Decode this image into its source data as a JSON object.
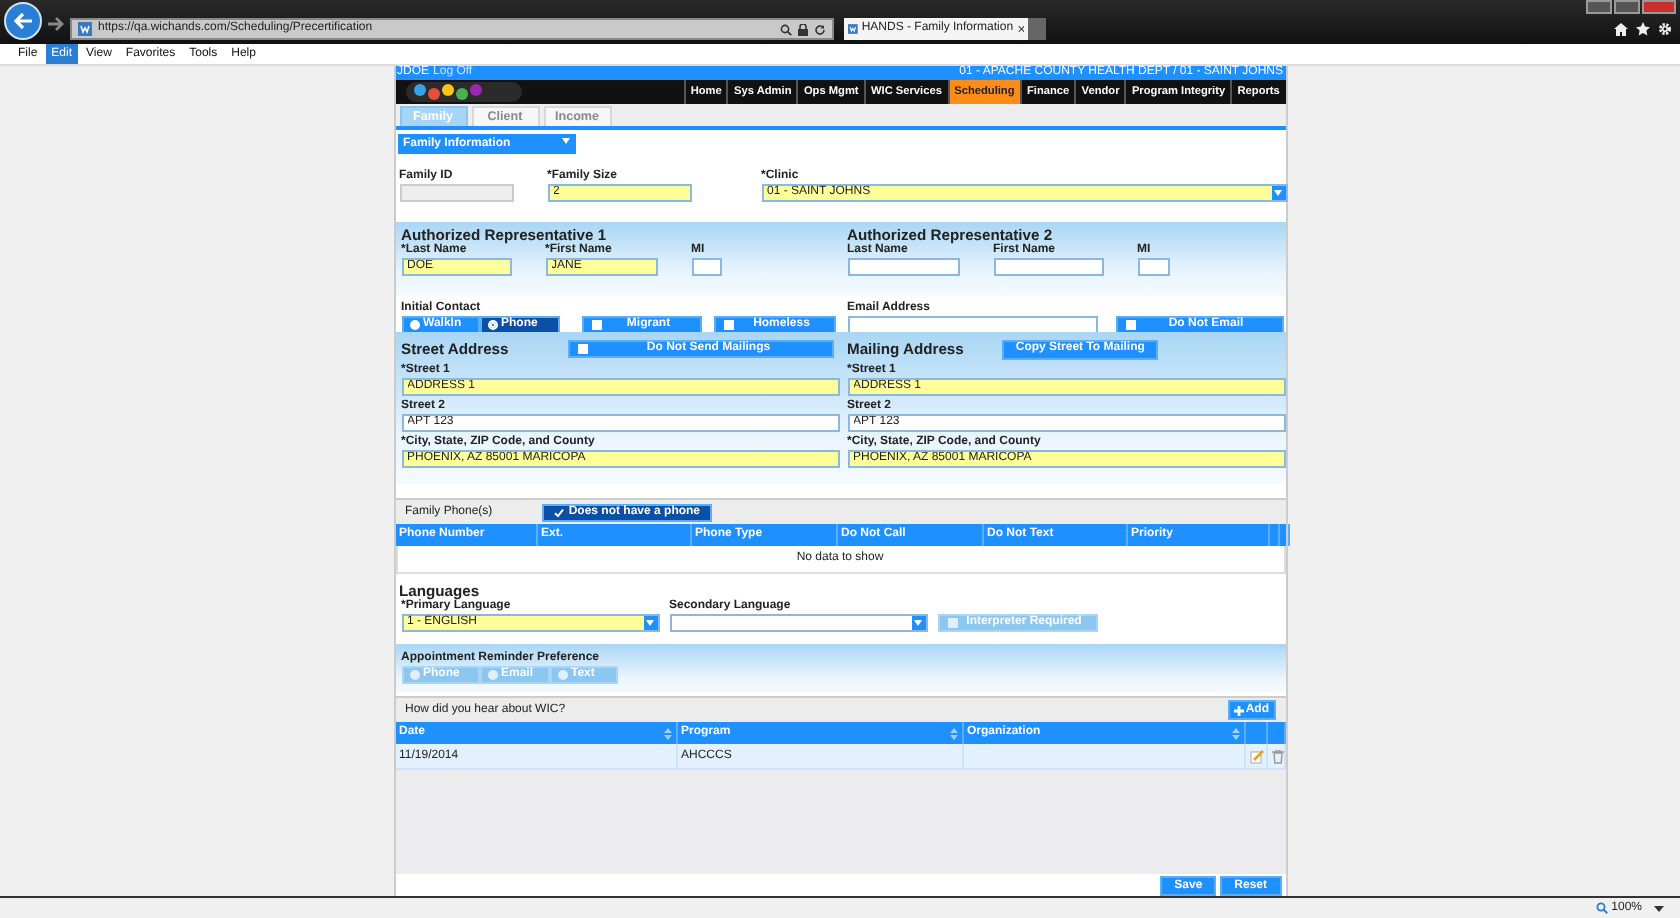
{
  "browser": {
    "url": "https://qa.wichands.com/Scheduling/Precertification",
    "tab_title": "HANDS - Family Information",
    "zoom": "100%",
    "menu": [
      {
        "label": "File",
        "selected": false
      },
      {
        "label": "Edit",
        "selected": true
      },
      {
        "label": "View",
        "selected": false
      },
      {
        "label": "Favorites",
        "selected": false
      },
      {
        "label": "Tools",
        "selected": false
      },
      {
        "label": "Help",
        "selected": false
      }
    ]
  },
  "header": {
    "user": "JDOE",
    "logoff": "Log Off",
    "location": "01 - APACHE COUNTY HEALTH DEPT / 01 - SAINT JOHNS"
  },
  "nav": [
    {
      "label": "Home",
      "selected": false
    },
    {
      "label": "Sys Admin",
      "selected": false
    },
    {
      "label": "Ops Mgmt",
      "selected": false
    },
    {
      "label": "WIC Services",
      "selected": false
    },
    {
      "label": "Scheduling",
      "selected": true
    },
    {
      "label": "Finance",
      "selected": false
    },
    {
      "label": "Vendor",
      "selected": false
    },
    {
      "label": "Program Integrity",
      "selected": false
    },
    {
      "label": "Reports",
      "selected": false
    }
  ],
  "tabs": [
    {
      "label": "Family",
      "selected": true
    },
    {
      "label": "Client",
      "selected": false
    },
    {
      "label": "Income",
      "selected": false
    }
  ],
  "section_menu": "Family Information",
  "family": {
    "family_id": {
      "label": "Family ID",
      "disabled": true
    },
    "family_size": {
      "label": "*Family Size",
      "value": "2",
      "required": true
    },
    "clinic": {
      "label": "*Clinic",
      "value": "01 - SAINT JOHNS",
      "required": true
    }
  },
  "rep1": {
    "title": "Authorized Representative 1",
    "fields": [
      {
        "label": "*Last Name",
        "value": "DOE",
        "required": true
      },
      {
        "label": "*First Name",
        "value": "JANE",
        "required": true
      },
      {
        "label": "MI",
        "required": false
      }
    ]
  },
  "rep2": {
    "title": "Authorized Representative 2",
    "fields": [
      {
        "label": "Last Name",
        "required": false
      },
      {
        "label": "First Name",
        "required": false
      },
      {
        "label": "MI",
        "required": false
      }
    ]
  },
  "initial_contact": {
    "label": "Initial Contact",
    "options": [
      {
        "label": "WalkIn",
        "selected": false
      },
      {
        "label": "Phone",
        "selected": true
      }
    ]
  },
  "flags": [
    {
      "label": "Migrant",
      "checked": false
    },
    {
      "label": "Homeless",
      "checked": false
    }
  ],
  "email": {
    "label": "Email Address",
    "required": false
  },
  "do_not_email": {
    "label": "Do Not Email",
    "checked": false
  },
  "street_address": {
    "title": "Street Address",
    "toggle": {
      "label": "Do Not Send Mailings",
      "checked": false
    },
    "fields": [
      {
        "label": "*Street 1",
        "value": "ADDRESS 1",
        "required": true
      },
      {
        "label": "Street 2",
        "value": "APT 123",
        "required": false
      },
      {
        "label": "*City, State, ZIP Code, and County",
        "value": "PHOENIX, AZ 85001 MARICOPA",
        "required": true
      }
    ]
  },
  "mailing_address": {
    "title": "Mailing Address",
    "button": "Copy Street To Mailing",
    "fields": [
      {
        "label": "*Street 1",
        "value": "ADDRESS 1",
        "required": true
      },
      {
        "label": "Street 2",
        "value": "APT 123",
        "required": false
      },
      {
        "label": "*City, State, ZIP Code, and County",
        "value": "PHOENIX, AZ 85001 MARICOPA",
        "required": true
      }
    ]
  },
  "phones": {
    "title": "Family Phone(s)",
    "toggle": {
      "label": "Does not have a phone",
      "checked": true
    },
    "columns": [
      "Phone Number",
      "Ext.",
      "Phone Type",
      "Do Not Call",
      "Do Not Text",
      "Priority"
    ],
    "empty_message": "No data to show"
  },
  "languages": {
    "title": "Languages",
    "primary": {
      "label": "*Primary Language",
      "value": "1 - ENGLISH",
      "required": true
    },
    "secondary": {
      "label": "Secondary Language",
      "required": false
    },
    "interpreter": {
      "label": "Interpreter Required",
      "checked": false,
      "disabled": true
    }
  },
  "reminder": {
    "title": "Appointment Reminder Preference",
    "disabled": true,
    "options": [
      {
        "label": "Phone",
        "selected": false
      },
      {
        "label": "Email",
        "selected": false
      },
      {
        "label": "Text",
        "selected": false
      }
    ]
  },
  "referrals": {
    "title": "How did you hear about WIC?",
    "add_button": "Add",
    "columns": [
      "Date",
      "Program",
      "Organization"
    ],
    "rows": [
      {
        "date": "11/19/2014",
        "program": "AHCCCS"
      }
    ]
  },
  "actions": [
    "Save",
    "Reset"
  ]
}
